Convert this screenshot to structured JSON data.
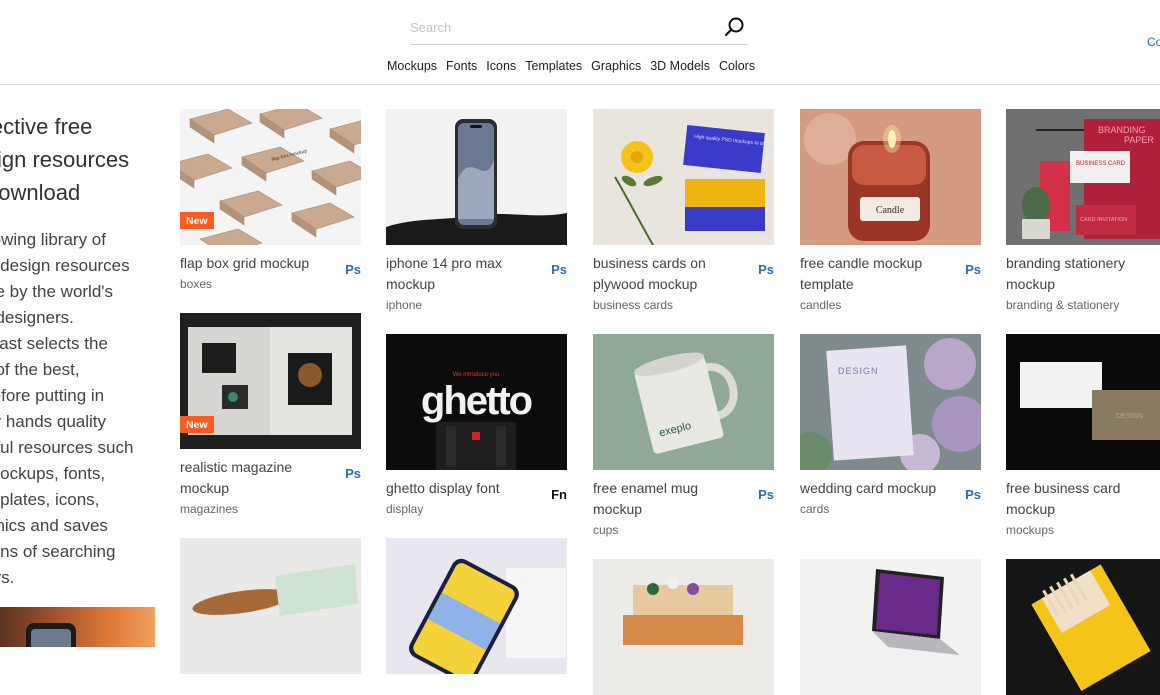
{
  "search": {
    "placeholder": "Search"
  },
  "nav": [
    "Mockups",
    "Fonts",
    "Icons",
    "Templates",
    "Graphics",
    "3D Models",
    "Colors"
  ],
  "top_right_link": "Co",
  "intro": {
    "title": "lective free sign resources download",
    "title_lines": [
      "lective free",
      "sign resources",
      "download"
    ],
    "text_lines": [
      "rowing library of",
      "e design resources",
      "de by the world's",
      "t designers.",
      "plast selects the",
      "t of the best,",
      "refore putting in",
      "ur hands quality",
      "eful resources such",
      "mockups, fonts,",
      "mplates, icons,",
      "phics and saves",
      "tons of searching",
      "urs."
    ]
  },
  "badge_new": "New",
  "cards": [
    {
      "title": "flap box grid mockup",
      "tag": "boxes",
      "format": "Ps",
      "new": true
    },
    {
      "title": "iphone 14 pro max mockup",
      "tag": "iphone",
      "format": "Ps"
    },
    {
      "title": "business cards on plywood mockup",
      "tag": "business cards",
      "format": "Ps"
    },
    {
      "title": "free candle mockup template",
      "tag": "candles",
      "format": "Ps"
    },
    {
      "title": "branding stationery mockup",
      "tag": "branding & stationery",
      "format": "Ps"
    },
    {
      "title": "realistic magazine mockup",
      "tag": "magazines",
      "format": "Ps",
      "new": true
    },
    {
      "title": "ghetto display font",
      "tag": "display",
      "format": "Fn"
    },
    {
      "title": "free enamel mug mockup",
      "tag": "cups",
      "format": "Ps"
    },
    {
      "title": "wedding card mockup",
      "tag": "cards",
      "format": "Ps"
    },
    {
      "title": "free business card mockup",
      "tag": "mockups",
      "format": "Ps"
    }
  ],
  "thumb_text": {
    "candle_label": "Candle",
    "ghetto_word": "ghetto",
    "ghetto_intro": "We introduce you",
    "mug_word": "exeplo",
    "wedding_word": "DESIGN",
    "branding_word": "BRANDING",
    "branding_word2": "PAPER",
    "business_card": "BUSINESS CARD",
    "invitation": "CARD INVITATION",
    "bc_design": "DESIGN",
    "box_label": "flap box mockup",
    "plywood_text": "High quality PSD mockups to showcase your work"
  },
  "colors": {
    "accent_blue": "#2f6fb7",
    "badge_orange": "#ff5a1f",
    "link_blue": "#1a6fc4"
  }
}
